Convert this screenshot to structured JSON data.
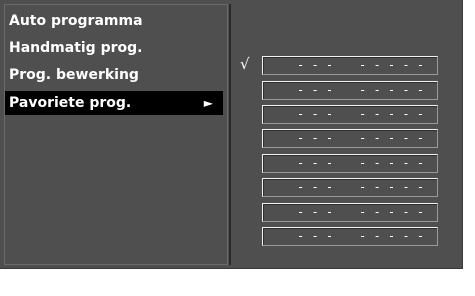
{
  "menu": {
    "items": [
      {
        "label": "Auto programma"
      },
      {
        "label": "Handmatig prog."
      },
      {
        "label": "Prog. bewerking"
      },
      {
        "label": "Pavoriete prog.",
        "arrow": "►"
      }
    ]
  },
  "favorites": {
    "check_mark": "√",
    "slots": [
      {
        "number": "- - -",
        "name": "- - - - -"
      },
      {
        "number": "- - -",
        "name": "- - - - -"
      },
      {
        "number": "- - -",
        "name": "- - - - -"
      },
      {
        "number": "- - -",
        "name": "- - - - -"
      },
      {
        "number": "- - -",
        "name": "- - - - -"
      },
      {
        "number": "- - -",
        "name": "- - - - -"
      },
      {
        "number": "- - -",
        "name": "- - - - -"
      },
      {
        "number": "- - -",
        "name": "- - - - -"
      }
    ]
  },
  "colors": {
    "panel": "#4f4f4f",
    "highlight": "#000000",
    "text": "#ffffff"
  }
}
